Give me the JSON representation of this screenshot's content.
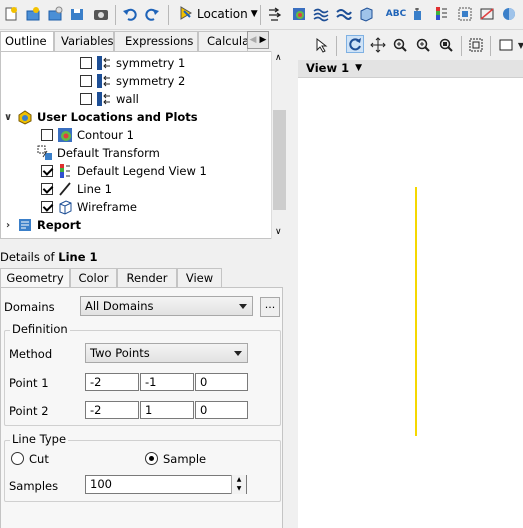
{
  "toolbar": {
    "location_label": "Location",
    "icons": [
      "new-file-icon",
      "open-icon",
      "open-folder-icon",
      "save-icon",
      "snapshot-icon",
      "undo-icon",
      "redo-icon",
      "location-icon",
      "vector-icon",
      "contour-icon",
      "streamline-icon",
      "volume-icon",
      "text-icon",
      "legend-icon",
      "instance-icon",
      "clip-plane-icon",
      "color-map-icon"
    ]
  },
  "outline_tabs": [
    "Outline",
    "Variables",
    "Expressions",
    "Calcula"
  ],
  "tree": {
    "items": [
      {
        "label": "symmetry 1",
        "checked": false
      },
      {
        "label": "symmetry 2",
        "checked": false
      },
      {
        "label": "wall",
        "checked": false
      },
      {
        "label": "User Locations and Plots"
      },
      {
        "label": "Contour 1",
        "checked": false
      },
      {
        "label": "Default Transform"
      },
      {
        "label": "Default Legend View 1",
        "checked": true
      },
      {
        "label": "Line 1",
        "checked": true
      },
      {
        "label": "Wireframe",
        "checked": true
      },
      {
        "label": "Report"
      }
    ]
  },
  "details": {
    "prefix": "Details of ",
    "object": "Line 1",
    "tabs": [
      "Geometry",
      "Color",
      "Render",
      "View"
    ],
    "domains_label": "Domains",
    "domains_value": "All Domains",
    "dots_label": "...",
    "definition_label": "Definition",
    "method_label": "Method",
    "method_value": "Two Points",
    "point1_label": "Point 1",
    "point1": [
      "-2",
      "-1",
      "0"
    ],
    "point2_label": "Point 2",
    "point2": [
      "-2",
      "1",
      "0"
    ],
    "line_type_label": "Line Type",
    "cut_label": "Cut",
    "sample_label": "Sample",
    "line_type_selected": "Sample",
    "samples_label": "Samples",
    "samples_value": "100"
  },
  "viewer": {
    "view_label": "View 1",
    "line_color": "#f5d800"
  }
}
